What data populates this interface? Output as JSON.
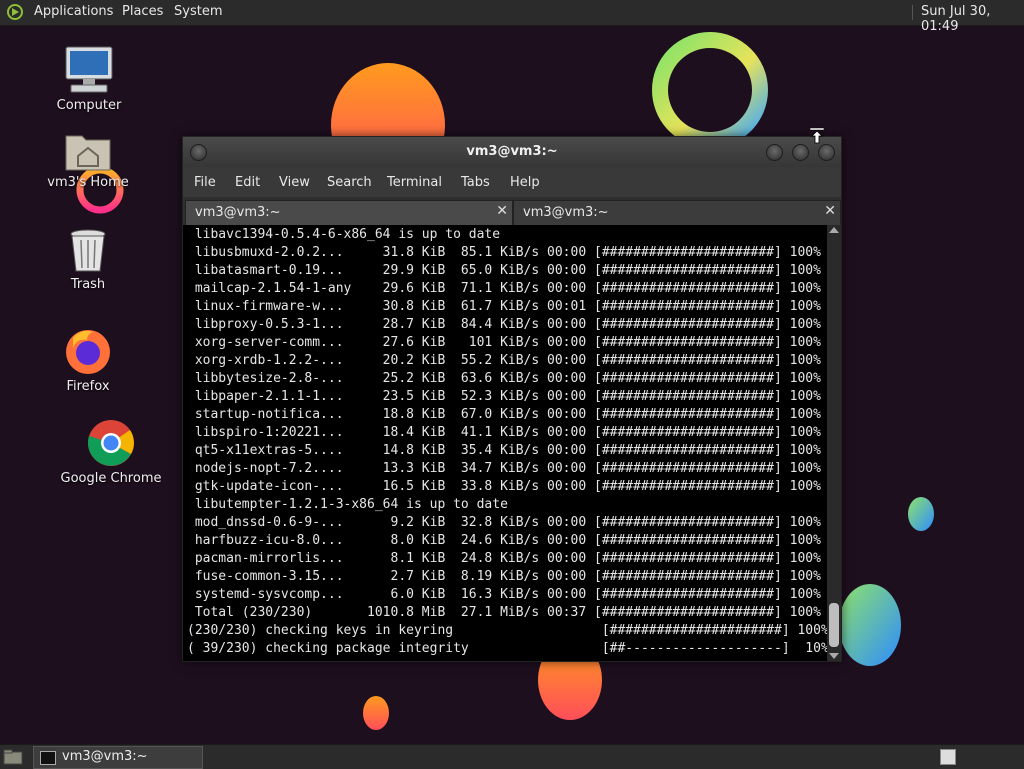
{
  "top_panel": {
    "menus": [
      "Applications",
      "Places",
      "System"
    ],
    "clock": "Sun Jul 30, 01:49"
  },
  "desktop_icons": [
    {
      "label": "Computer",
      "icon": "computer-icon"
    },
    {
      "label": "vm3's Home",
      "icon": "home-folder-icon"
    },
    {
      "label": "Trash",
      "icon": "trash-icon"
    },
    {
      "label": "Firefox",
      "icon": "firefox-icon"
    },
    {
      "label": "Google Chrome",
      "icon": "chrome-icon"
    }
  ],
  "window": {
    "title": "vm3@vm3:~",
    "menu": [
      "File",
      "Edit",
      "View",
      "Search",
      "Terminal",
      "Tabs",
      "Help"
    ],
    "tabs": [
      {
        "label": "vm3@vm3:~",
        "active": true
      },
      {
        "label": "vm3@vm3:~",
        "active": false
      }
    ],
    "terminal_lines": [
      " libavc1394-0.5.4-6-x86_64 is up to date",
      " libusbmuxd-2.0.2...     31.8 KiB  85.1 KiB/s 00:00 [######################] 100%",
      " libatasmart-0.19...     29.9 KiB  65.0 KiB/s 00:00 [######################] 100%",
      " mailcap-2.1.54-1-any    29.6 KiB  71.1 KiB/s 00:00 [######################] 100%",
      " linux-firmware-w...     30.8 KiB  61.7 KiB/s 00:01 [######################] 100%",
      " libproxy-0.5.3-1...     28.7 KiB  84.4 KiB/s 00:00 [######################] 100%",
      " xorg-server-comm...     27.6 KiB   101 KiB/s 00:00 [######################] 100%",
      " xorg-xrdb-1.2.2-...     20.2 KiB  55.2 KiB/s 00:00 [######################] 100%",
      " libbytesize-2.8-...     25.2 KiB  63.6 KiB/s 00:00 [######################] 100%",
      " libpaper-2.1.1-1...     23.5 KiB  52.3 KiB/s 00:00 [######################] 100%",
      " startup-notifica...     18.8 KiB  67.0 KiB/s 00:00 [######################] 100%",
      " libspiro-1:20221...     18.4 KiB  41.1 KiB/s 00:00 [######################] 100%",
      " qt5-x11extras-5....     14.8 KiB  35.4 KiB/s 00:00 [######################] 100%",
      " nodejs-nopt-7.2....     13.3 KiB  34.7 KiB/s 00:00 [######################] 100%",
      " gtk-update-icon-...     16.5 KiB  33.8 KiB/s 00:00 [######################] 100%",
      " libutempter-1.2.1-3-x86_64 is up to date",
      " mod_dnssd-0.6-9-...      9.2 KiB  32.8 KiB/s 00:00 [######################] 100%",
      " harfbuzz-icu-8.0...      8.0 KiB  24.6 KiB/s 00:00 [######################] 100%",
      " pacman-mirrorlis...      8.1 KiB  24.8 KiB/s 00:00 [######################] 100%",
      " fuse-common-3.15...      2.7 KiB  8.19 KiB/s 00:00 [######################] 100%",
      " systemd-sysvcomp...      6.0 KiB  16.3 KiB/s 00:00 [######################] 100%",
      " Total (230/230)       1010.8 MiB  27.1 MiB/s 00:37 [######################] 100%",
      "(230/230) checking keys in keyring                   [######################] 100%",
      "( 39/230) checking package integrity                 [##--------------------]  10%"
    ]
  },
  "taskbar": {
    "task_label": "vm3@vm3:~"
  }
}
